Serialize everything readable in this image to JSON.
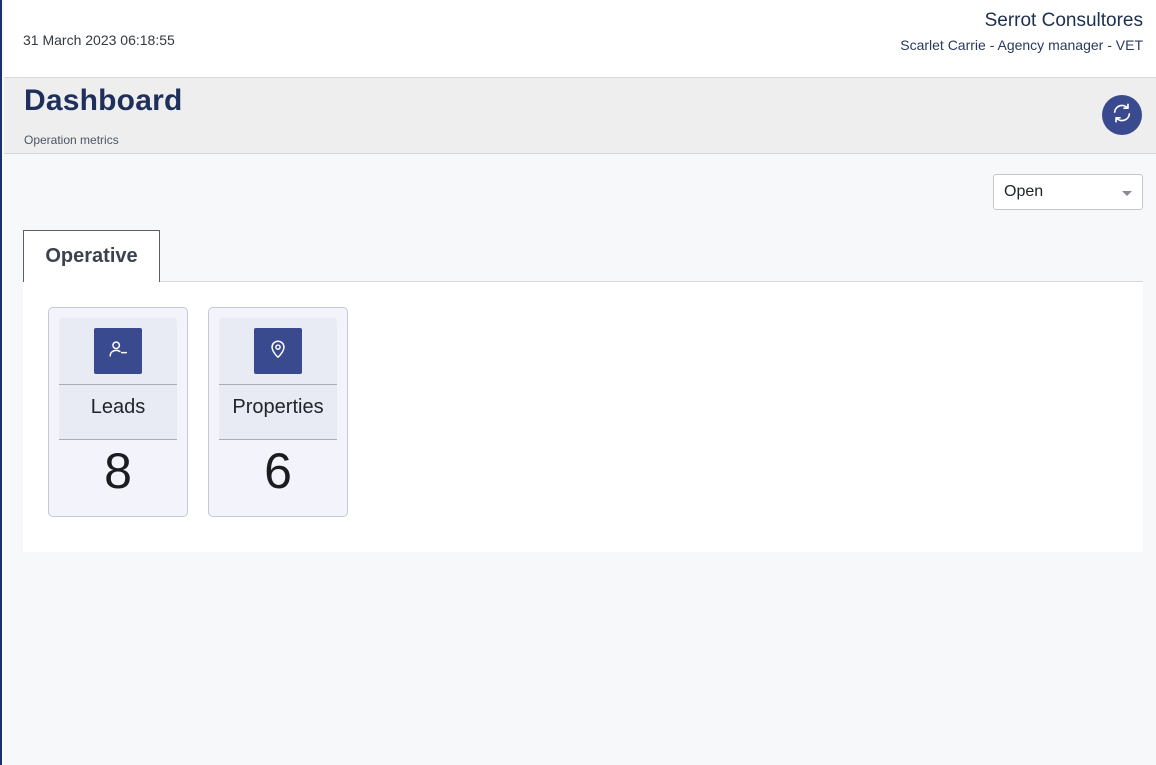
{
  "header": {
    "datetime": "31 March 2023 06:18:55",
    "company": "Serrot Consultores",
    "user": "Scarlet Carrie - Agency manager - VET"
  },
  "page": {
    "title": "Dashboard",
    "subtitle": "Operation metrics",
    "refresh_icon": "refresh-icon"
  },
  "filter": {
    "selected": "Open"
  },
  "tabs": [
    {
      "label": "Operative",
      "active": true
    }
  ],
  "metrics": [
    {
      "label": "Leads",
      "value": "8",
      "icon": "user-minus-icon"
    },
    {
      "label": "Properties",
      "value": "6",
      "icon": "map-pin-icon"
    }
  ],
  "colors": {
    "accent": "#3a4a8e",
    "title": "#1d2f5a",
    "page_bg": "#f7f8fa",
    "header_band": "#eeeeef"
  }
}
